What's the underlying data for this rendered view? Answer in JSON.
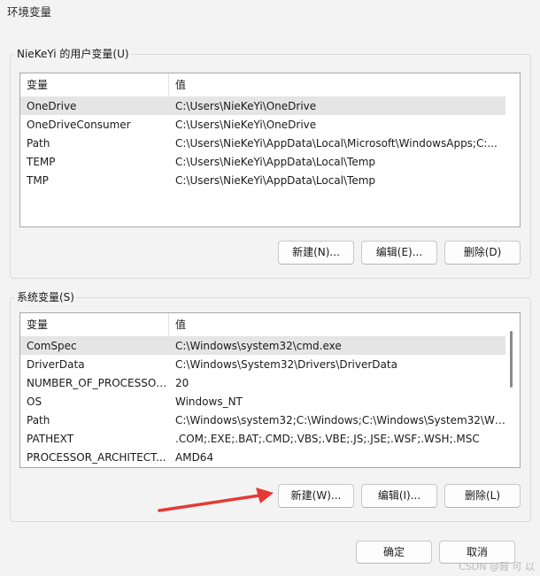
{
  "window": {
    "title": "环境变量"
  },
  "user_vars": {
    "group_label": "NieKeYi 的用户变量(U)",
    "columns": [
      "变量",
      "值"
    ],
    "rows": [
      {
        "name": "OneDrive",
        "value": "C:\\Users\\NieKeYi\\OneDrive"
      },
      {
        "name": "OneDriveConsumer",
        "value": "C:\\Users\\NieKeYi\\OneDrive"
      },
      {
        "name": "Path",
        "value": "C:\\Users\\NieKeYi\\AppData\\Local\\Microsoft\\WindowsApps;C:..."
      },
      {
        "name": "TEMP",
        "value": "C:\\Users\\NieKeYi\\AppData\\Local\\Temp"
      },
      {
        "name": "TMP",
        "value": "C:\\Users\\NieKeYi\\AppData\\Local\\Temp"
      }
    ],
    "new_label": "新建(N)...",
    "edit_label": "编辑(E)...",
    "delete_label": "删除(D)"
  },
  "system_vars": {
    "group_label": "系统变量(S)",
    "columns": [
      "变量",
      "值"
    ],
    "rows": [
      {
        "name": "ComSpec",
        "value": "C:\\Windows\\system32\\cmd.exe"
      },
      {
        "name": "DriverData",
        "value": "C:\\Windows\\System32\\Drivers\\DriverData"
      },
      {
        "name": "NUMBER_OF_PROCESSORS",
        "value": "20"
      },
      {
        "name": "OS",
        "value": "Windows_NT"
      },
      {
        "name": "Path",
        "value": "C:\\Windows\\system32;C:\\Windows;C:\\Windows\\System32\\Wb..."
      },
      {
        "name": "PATHEXT",
        "value": ".COM;.EXE;.BAT;.CMD;.VBS;.VBE;.JS;.JSE;.WSF;.WSH;.MSC"
      },
      {
        "name": "PROCESSOR_ARCHITECT...",
        "value": "AMD64"
      }
    ],
    "new_label": "新建(W)...",
    "edit_label": "编辑(I)...",
    "delete_label": "删除(L)"
  },
  "footer": {
    "ok_label": "确定",
    "cancel_label": "取消"
  },
  "annotation": {
    "arrow_color": "#e53935"
  },
  "watermark": "CSDN @聂 可 以"
}
